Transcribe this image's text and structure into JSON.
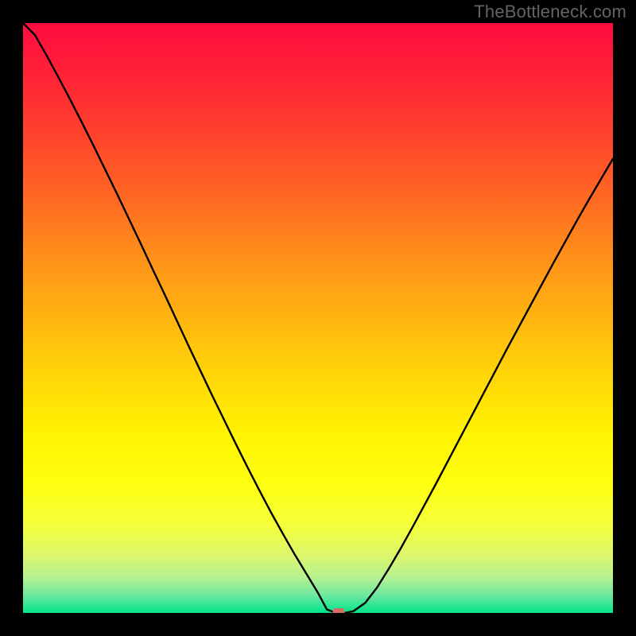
{
  "watermark": "TheBottleneck.com",
  "chart_data": {
    "type": "line",
    "title": "",
    "xlabel": "",
    "ylabel": "",
    "xlim": [
      0,
      1
    ],
    "ylim": [
      0,
      1
    ],
    "x": [
      0.0,
      0.02,
      0.04,
      0.06,
      0.08,
      0.1,
      0.12,
      0.14,
      0.16,
      0.18,
      0.2,
      0.22,
      0.24,
      0.26,
      0.28,
      0.3,
      0.32,
      0.34,
      0.36,
      0.38,
      0.4,
      0.42,
      0.44,
      0.46,
      0.48,
      0.5,
      0.515,
      0.53,
      0.545,
      0.56,
      0.58,
      0.6,
      0.62,
      0.64,
      0.66,
      0.68,
      0.7,
      0.72,
      0.74,
      0.76,
      0.78,
      0.8,
      0.82,
      0.84,
      0.86,
      0.88,
      0.9,
      0.92,
      0.94,
      0.96,
      0.98,
      1.0
    ],
    "values": [
      1.0,
      0.98,
      0.945,
      0.908,
      0.87,
      0.831,
      0.791,
      0.75,
      0.709,
      0.667,
      0.625,
      0.582,
      0.54,
      0.497,
      0.454,
      0.412,
      0.37,
      0.329,
      0.288,
      0.248,
      0.209,
      0.171,
      0.135,
      0.1,
      0.067,
      0.034,
      0.006,
      0.0,
      0.0,
      0.003,
      0.017,
      0.043,
      0.075,
      0.109,
      0.145,
      0.182,
      0.219,
      0.257,
      0.295,
      0.333,
      0.371,
      0.409,
      0.447,
      0.484,
      0.521,
      0.558,
      0.595,
      0.631,
      0.667,
      0.702,
      0.736,
      0.77
    ],
    "gradient_stops": [
      {
        "offset": 0.0,
        "color": "#ff0b3f"
      },
      {
        "offset": 0.1,
        "color": "#ff2635"
      },
      {
        "offset": 0.2,
        "color": "#ff462b"
      },
      {
        "offset": 0.3,
        "color": "#ff6a22"
      },
      {
        "offset": 0.4,
        "color": "#ff9119"
      },
      {
        "offset": 0.5,
        "color": "#ffb510"
      },
      {
        "offset": 0.6,
        "color": "#ffd708"
      },
      {
        "offset": 0.7,
        "color": "#fff402"
      },
      {
        "offset": 0.78,
        "color": "#ffff10"
      },
      {
        "offset": 0.85,
        "color": "#f4ff3a"
      },
      {
        "offset": 0.9,
        "color": "#def76a"
      },
      {
        "offset": 0.94,
        "color": "#b6f190"
      },
      {
        "offset": 0.97,
        "color": "#6de8a0"
      },
      {
        "offset": 1.0,
        "color": "#00e48a"
      }
    ],
    "marker": {
      "x": 0.535,
      "y": 0.002,
      "color": "#d96a61"
    }
  }
}
